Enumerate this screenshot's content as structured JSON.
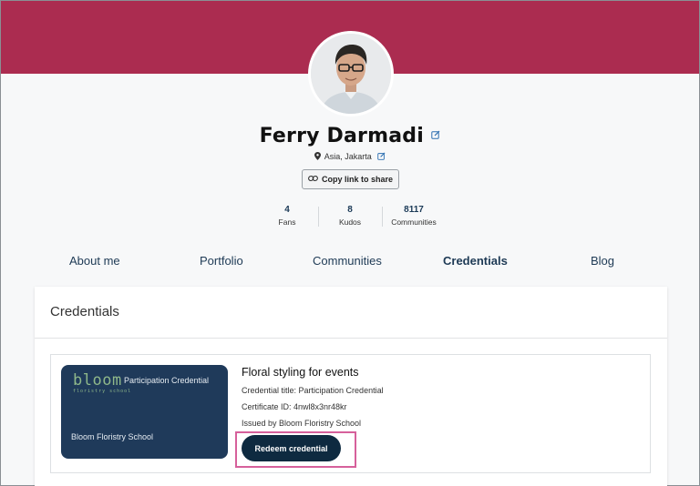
{
  "colors": {
    "banner": "#ab2c50",
    "primary_text": "#1e3a55",
    "badge_bg": "#1f3a5a",
    "button_bg": "#0e2a40",
    "highlight": "#d6609b"
  },
  "profile": {
    "name": "Ferry Darmadi",
    "location": "Asia, Jakarta",
    "share_label": "Copy link to share",
    "stats": [
      {
        "value": "4",
        "label": "Fans"
      },
      {
        "value": "8",
        "label": "Kudos"
      },
      {
        "value": "8117",
        "label": "Communities"
      }
    ]
  },
  "nav": {
    "items": [
      {
        "label": "About me",
        "active": false
      },
      {
        "label": "Portfolio",
        "active": false
      },
      {
        "label": "Communities",
        "active": false
      },
      {
        "label": "Credentials",
        "active": true
      },
      {
        "label": "Blog",
        "active": false
      }
    ]
  },
  "credentials": {
    "section_title": "Credentials",
    "items": [
      {
        "badge": {
          "logo_main": "bloom",
          "logo_sub": "floristry school",
          "type": "Participation Credential",
          "issuer": "Bloom Floristry School"
        },
        "title": "Floral styling for events",
        "credential_title": "Credential title: Participation Credential",
        "certificate_id": "Certificate ID: 4nwl8x3nr48kr",
        "issued_by": "Issued by Bloom Floristry School",
        "redeem_label": "Redeem credential"
      }
    ]
  }
}
